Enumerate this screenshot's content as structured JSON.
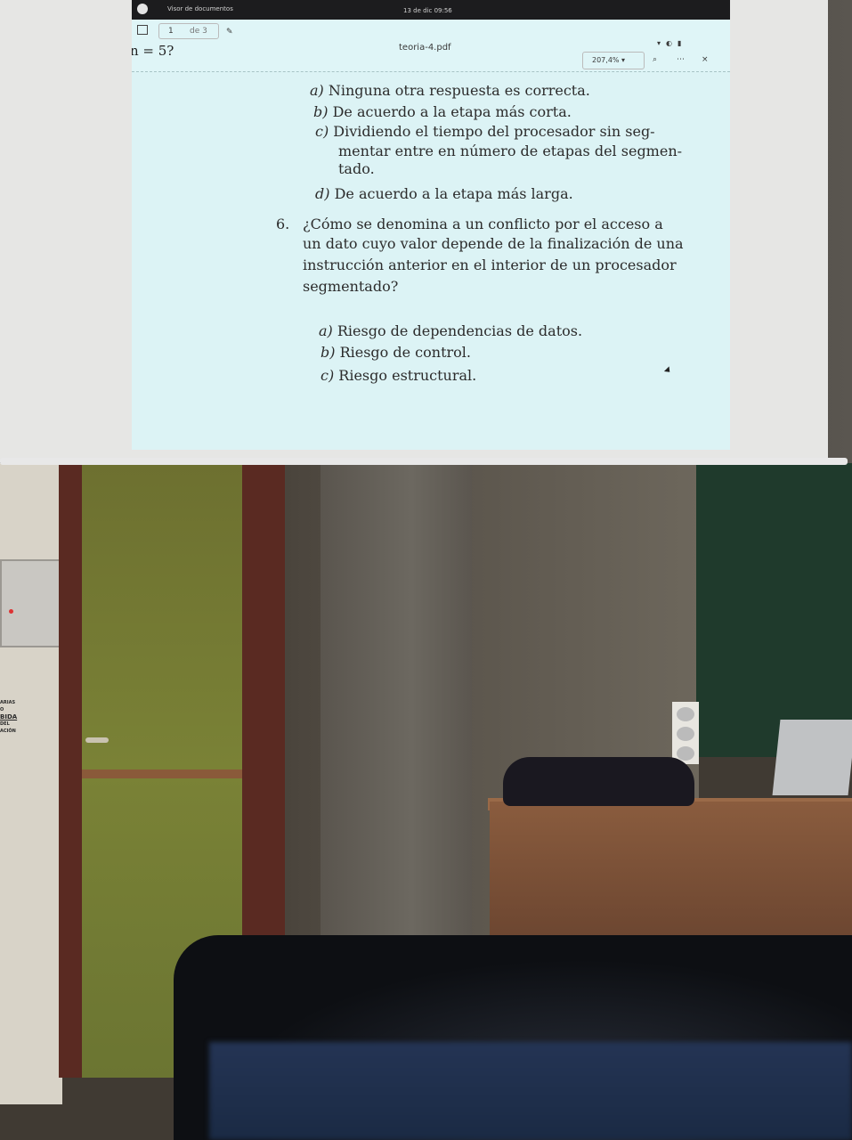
{
  "window": {
    "app_title": "Visor de documentos",
    "clock": "13 de dic  09:56",
    "page_current": "1",
    "page_total": "de 3",
    "doc_title": "teoria-4.pdf",
    "zoom": "207,4% ▾",
    "cut_text": "n = 5?"
  },
  "icons": {
    "sidebar": "sidebar-icon",
    "annotate": "pencil-icon",
    "search": "search-icon",
    "menu": "more-icon",
    "close": "close-icon"
  },
  "document": {
    "prev_options": [
      {
        "label": "a)",
        "text": "Ninguna otra respuesta es correcta."
      },
      {
        "label": "b)",
        "text": "De acuerdo a la etapa más corta."
      },
      {
        "label": "c)",
        "lines": [
          "Dividiendo el tiempo del procesador sin seg-",
          "mentar entre en número de etapas del segmen-",
          "tado."
        ]
      },
      {
        "label": "d)",
        "text": "De acuerdo a la etapa más larga."
      }
    ],
    "question": {
      "number": "6.",
      "lines": [
        "¿Cómo se denomina a un conflicto por el acceso a",
        "un dato cuyo valor depende de la finalización de una",
        "instrucción anterior en el interior de un procesador",
        "segmentado?"
      ],
      "options": [
        {
          "label": "a)",
          "text": "Riesgo de dependencias de datos."
        },
        {
          "label": "b)",
          "text": "Riesgo de control."
        },
        {
          "label": "c)",
          "text": "Riesgo estructural."
        }
      ]
    }
  },
  "room": {
    "sign_lines": [
      "ARIAS",
      "O",
      "BIDA",
      "DEL",
      "ACIÓN"
    ]
  }
}
